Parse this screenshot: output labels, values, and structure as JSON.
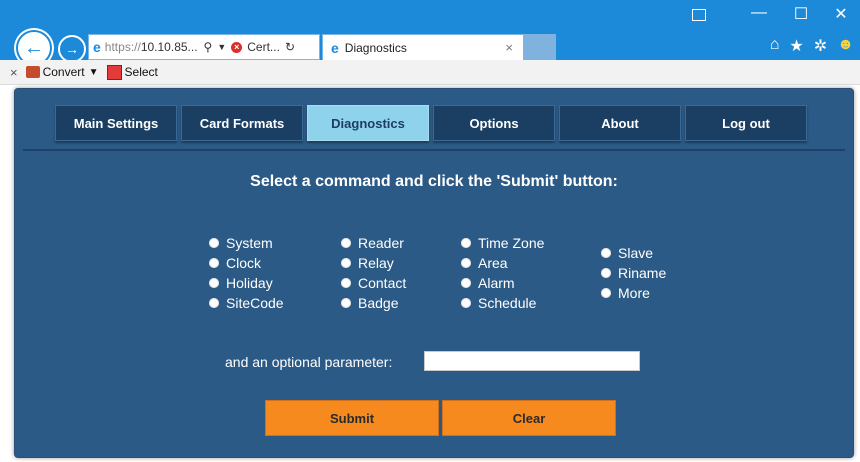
{
  "browser": {
    "address_protocol": "https://",
    "address_host": "10.10.85...",
    "address_search_glyph": "⚲",
    "address_cert": "Cert...",
    "address_refresh_glyph": "↻",
    "tab_title": "Diagnostics",
    "tab_close": "×",
    "window_min": "—",
    "window_max": "☐",
    "window_close": "✕",
    "icons": [
      "home-icon",
      "favorites-star-icon",
      "settings-gear-icon",
      "feedback-smiley-icon"
    ]
  },
  "command_bar": {
    "close": "×",
    "convert_label": "Convert",
    "select_label": "Select"
  },
  "nav": {
    "items": [
      {
        "label": "Main Settings",
        "active": false
      },
      {
        "label": "Card Formats",
        "active": false
      },
      {
        "label": "Diagnostics",
        "active": true
      },
      {
        "label": "Options",
        "active": false
      },
      {
        "label": "About",
        "active": false
      },
      {
        "label": "Log out",
        "active": false
      }
    ]
  },
  "main": {
    "heading": "Select a command and click the 'Submit' button:",
    "commands": {
      "col1": [
        "System",
        "Clock",
        "Holiday",
        "SiteCode"
      ],
      "col2": [
        "Reader",
        "Relay",
        "Contact",
        "Badge"
      ],
      "col3": [
        "Time Zone",
        "Area",
        "Alarm",
        "Schedule"
      ],
      "col4": [
        "Slave",
        "Riname",
        "More"
      ]
    },
    "param_label": "and an optional parameter:",
    "param_value": "",
    "submit_label": "Submit",
    "clear_label": "Clear"
  },
  "colors": {
    "title_bar": "#1c8ad8",
    "panel": "#2c5a86",
    "nav_button": "#1b3f63",
    "nav_active": "#8fd2ec",
    "action_button": "#f68a1e"
  }
}
